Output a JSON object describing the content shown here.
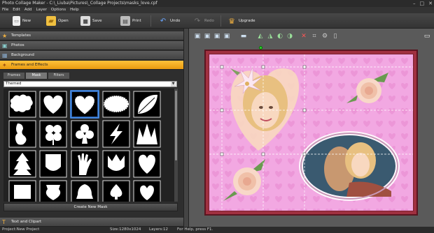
{
  "window": {
    "title": "Photo Collage Maker - C:\\_Liuba\\Pictures\\_Collage Projects\\masks_love.cpf",
    "minimize": "–",
    "maximize": "□",
    "close": "✕"
  },
  "menu": [
    "File",
    "Edit",
    "Add",
    "Layer",
    "Options",
    "Help"
  ],
  "toolbar": {
    "new": "New",
    "open": "Open",
    "save": "Save",
    "print": "Print",
    "undo": "Undo",
    "redo": "Redo",
    "upgrade": "Upgrade"
  },
  "sidebar": {
    "sections": [
      {
        "label": "Templates"
      },
      {
        "label": "Photos"
      },
      {
        "label": "Background"
      },
      {
        "label": "Frames and Effects"
      }
    ],
    "bottom_section": "Text and Clipart",
    "tabs": [
      "Frames",
      "Mask",
      "Filters"
    ],
    "category_select": "Themed",
    "create_mask_button": "Create New Mask"
  },
  "status": {
    "project": "Project:New Project",
    "size": "Size:1280x1024",
    "layers": "Layers:12",
    "help": "For Help, press F1."
  }
}
